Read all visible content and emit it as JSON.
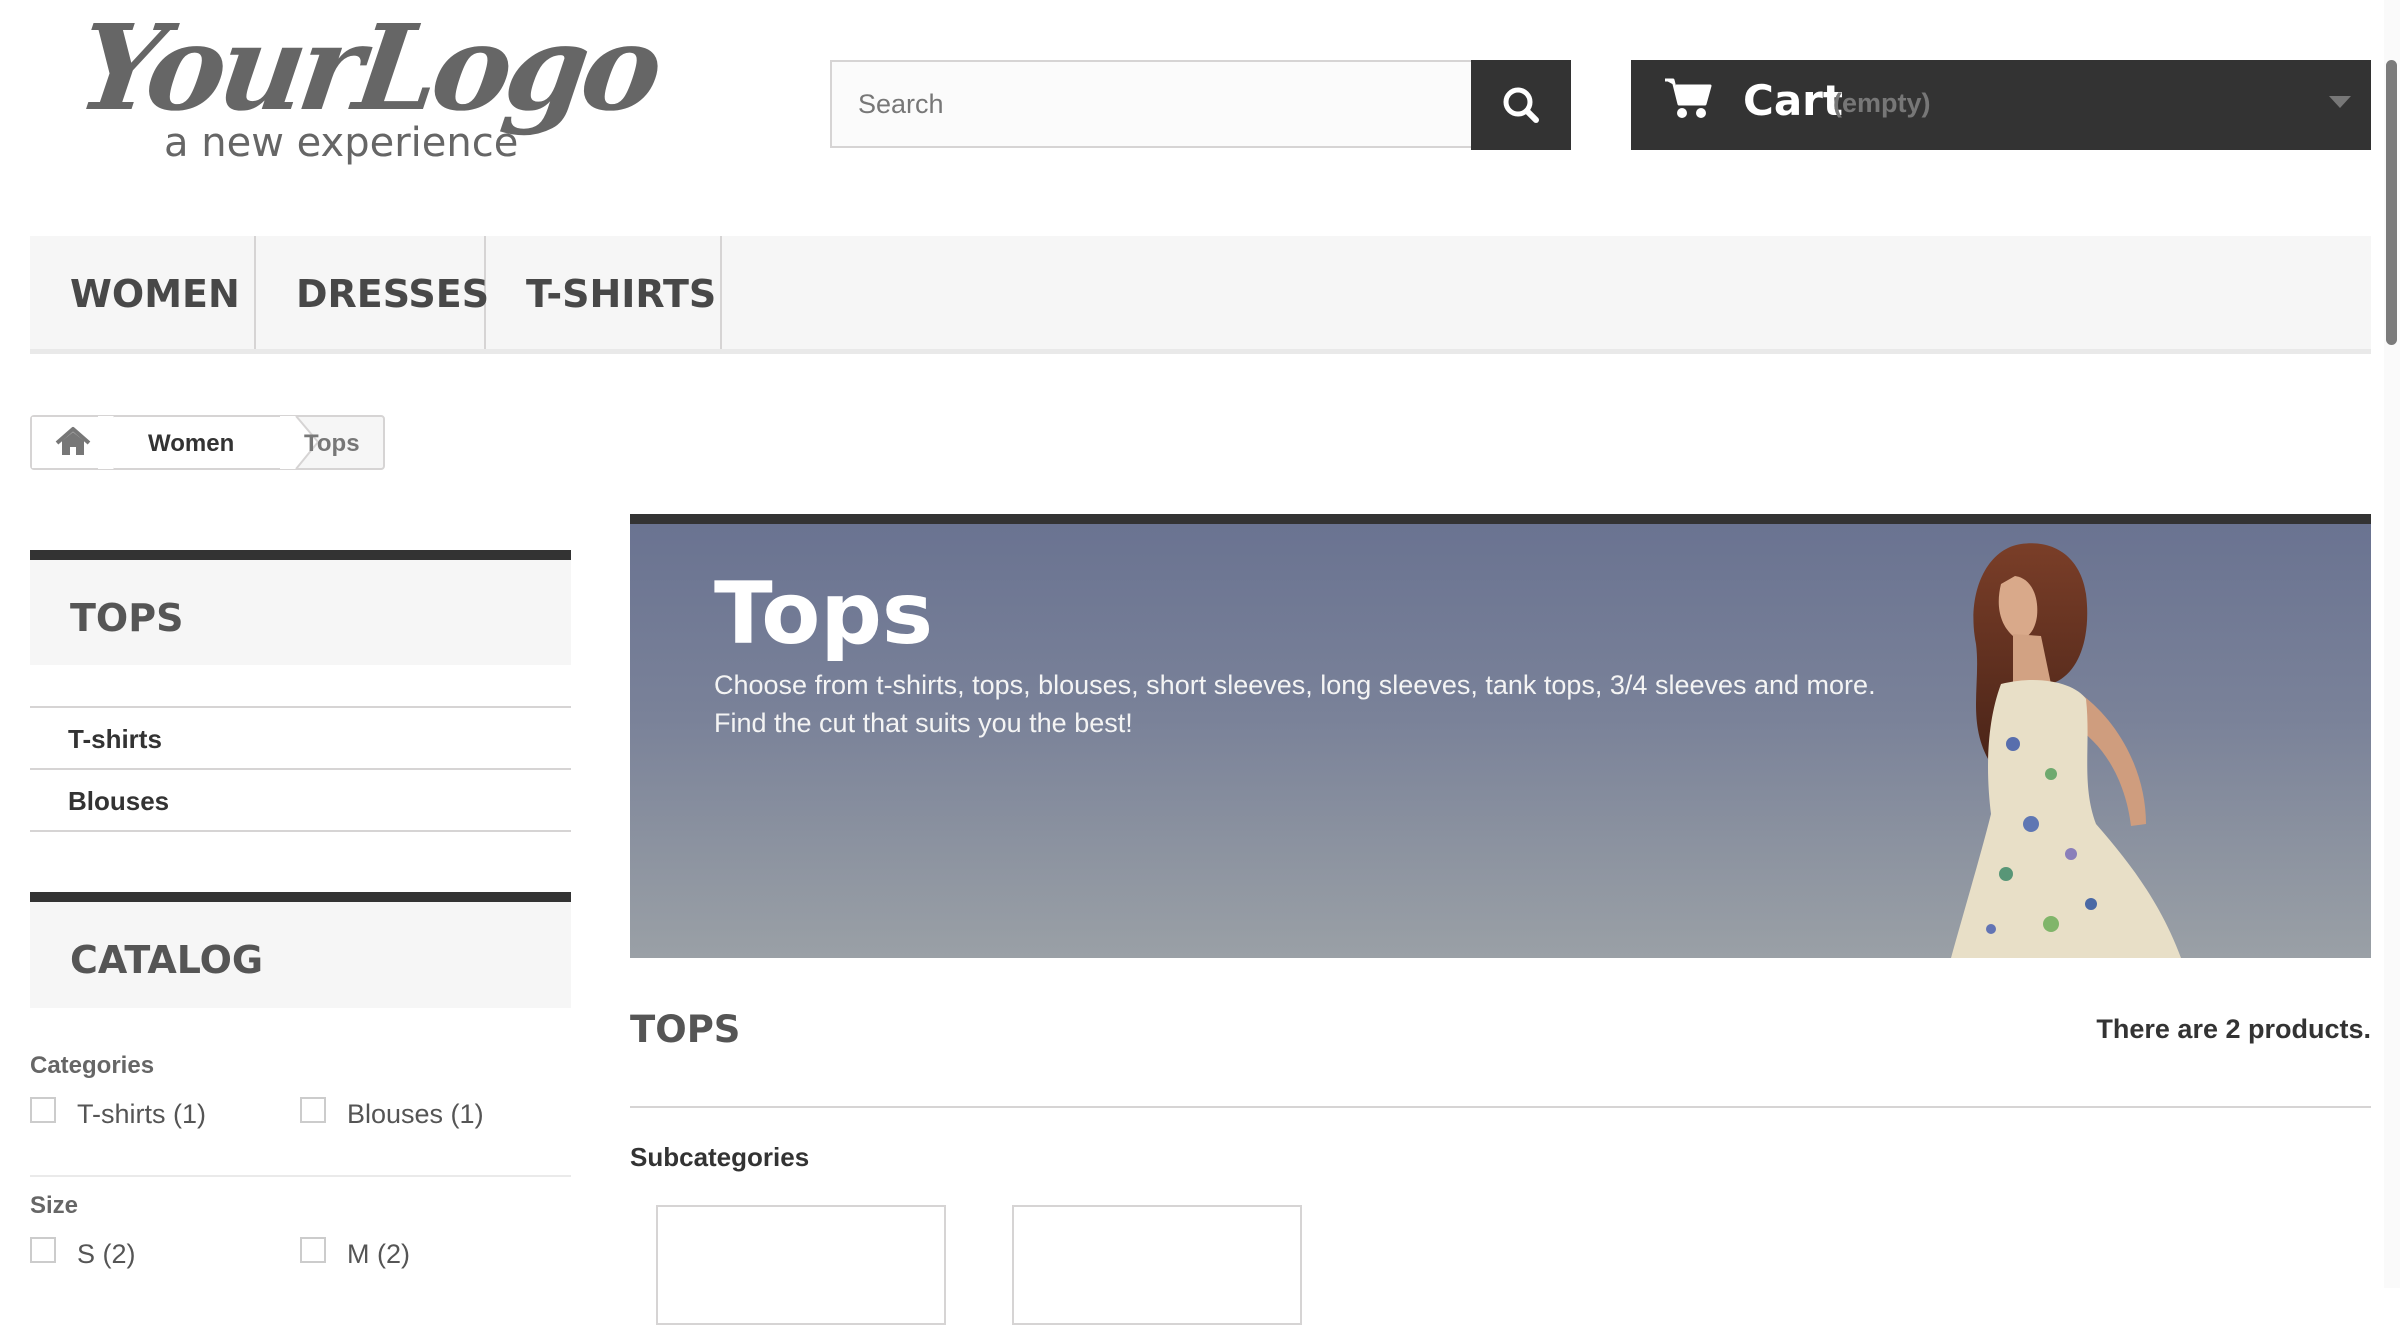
{
  "header": {
    "logo": {
      "text": "YourLogo",
      "tagline": "a new experience"
    },
    "search": {
      "placeholder": "Search",
      "value": "",
      "button_icon": "search-icon"
    },
    "cart": {
      "label": "Cart",
      "status": "(empty)",
      "icon": "cart-icon",
      "chevron_icon": "chevron-down-icon"
    }
  },
  "top_menu": {
    "items": [
      {
        "label": "WOMEN"
      },
      {
        "label": "DRESSES"
      },
      {
        "label": "T-SHIRTS"
      }
    ]
  },
  "breadcrumb": {
    "home_icon": "home-icon",
    "items": [
      {
        "label": "Women"
      },
      {
        "label": "Tops"
      }
    ]
  },
  "sidebar": {
    "categories_block": {
      "title": "TOPS",
      "items": [
        {
          "label": "T-shirts"
        },
        {
          "label": "Blouses"
        }
      ]
    },
    "catalog_block": {
      "title": "CATALOG",
      "filters": [
        {
          "title": "Categories",
          "options": [
            {
              "label": "T-shirts (1)",
              "checked": false
            },
            {
              "label": "Blouses (1)",
              "checked": false
            }
          ]
        },
        {
          "title": "Size",
          "options": [
            {
              "label": "S (2)",
              "checked": false
            },
            {
              "label": "M (2)",
              "checked": false
            }
          ]
        }
      ]
    }
  },
  "main": {
    "banner": {
      "title": "Tops",
      "description_line1": "Choose from t-shirts, tops, blouses, short sleeves, long sleeves, tank tops, 3/4 sleeves and more.",
      "description_line2": "Find the cut that suits you the best!"
    },
    "category_heading": "TOPS",
    "product_count": "There are 2 products.",
    "subcategories_title": "Subcategories"
  },
  "colors": {
    "dark": "#333333",
    "menu_background": "#f6f6f6",
    "border": "#d6d4d4"
  }
}
